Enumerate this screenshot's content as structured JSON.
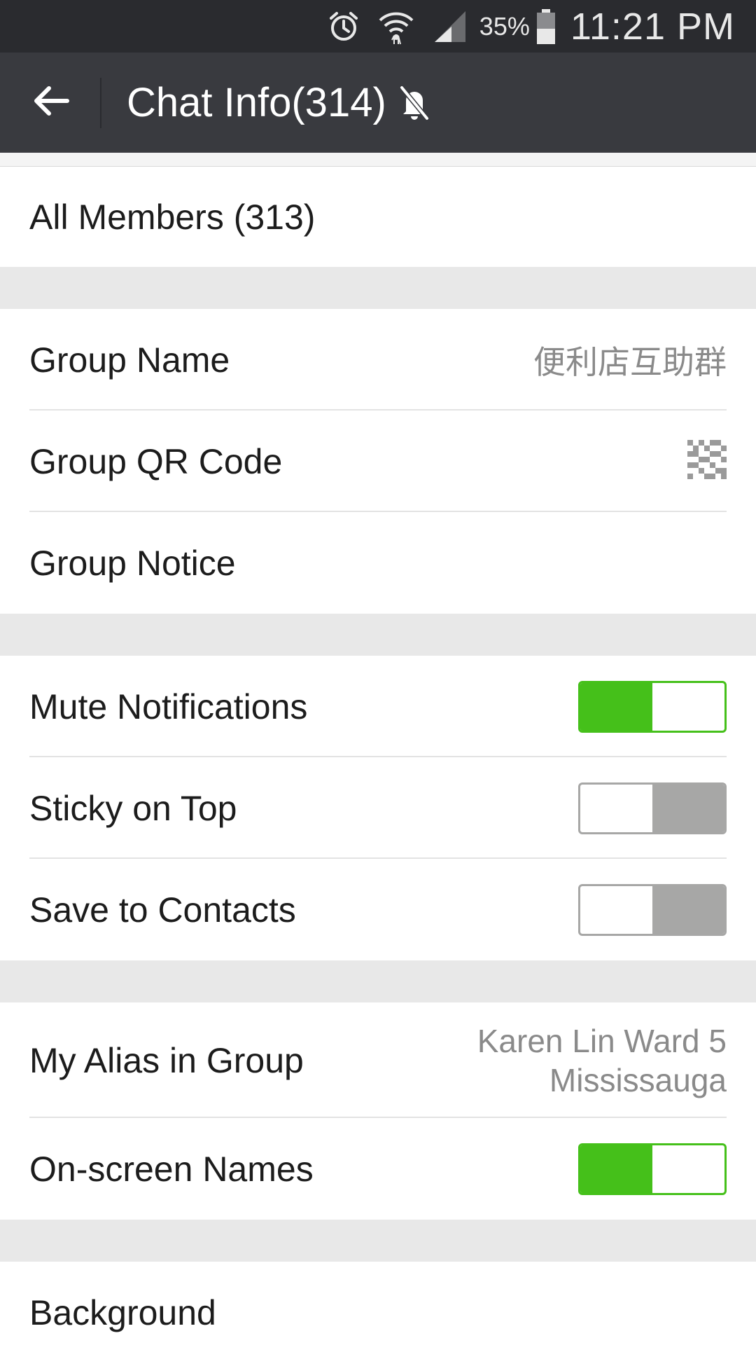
{
  "status_bar": {
    "battery_percent": "35%",
    "time": "11:21 PM",
    "icons": [
      "alarm-icon",
      "wifi-icon",
      "signal-icon",
      "battery-icon"
    ]
  },
  "app_bar": {
    "title": "Chat Info(314)",
    "icons": [
      "back-arrow-icon",
      "bell-off-icon"
    ]
  },
  "sections": {
    "members": {
      "label": "All Members (313)"
    },
    "group_name": {
      "label": "Group Name",
      "value": "便利店互助群"
    },
    "group_qr": {
      "label": "Group QR Code",
      "icon": "qr-code-icon"
    },
    "group_notice": {
      "label": "Group Notice"
    },
    "mute": {
      "label": "Mute Notifications",
      "on": true
    },
    "sticky": {
      "label": "Sticky on Top",
      "on": false
    },
    "save_contacts": {
      "label": "Save to Contacts",
      "on": false
    },
    "alias": {
      "label": "My Alias in Group",
      "value_line1": "Karen Lin Ward 5",
      "value_line2": "Mississauga"
    },
    "onscreen_names": {
      "label": "On-screen Names",
      "on": true
    },
    "background": {
      "label": "Background"
    }
  },
  "colors": {
    "toggle_on": "#45c01a",
    "toggle_off": "#a7a7a6",
    "app_bar": "#393a3f",
    "status_bar": "#2a2b2f"
  }
}
